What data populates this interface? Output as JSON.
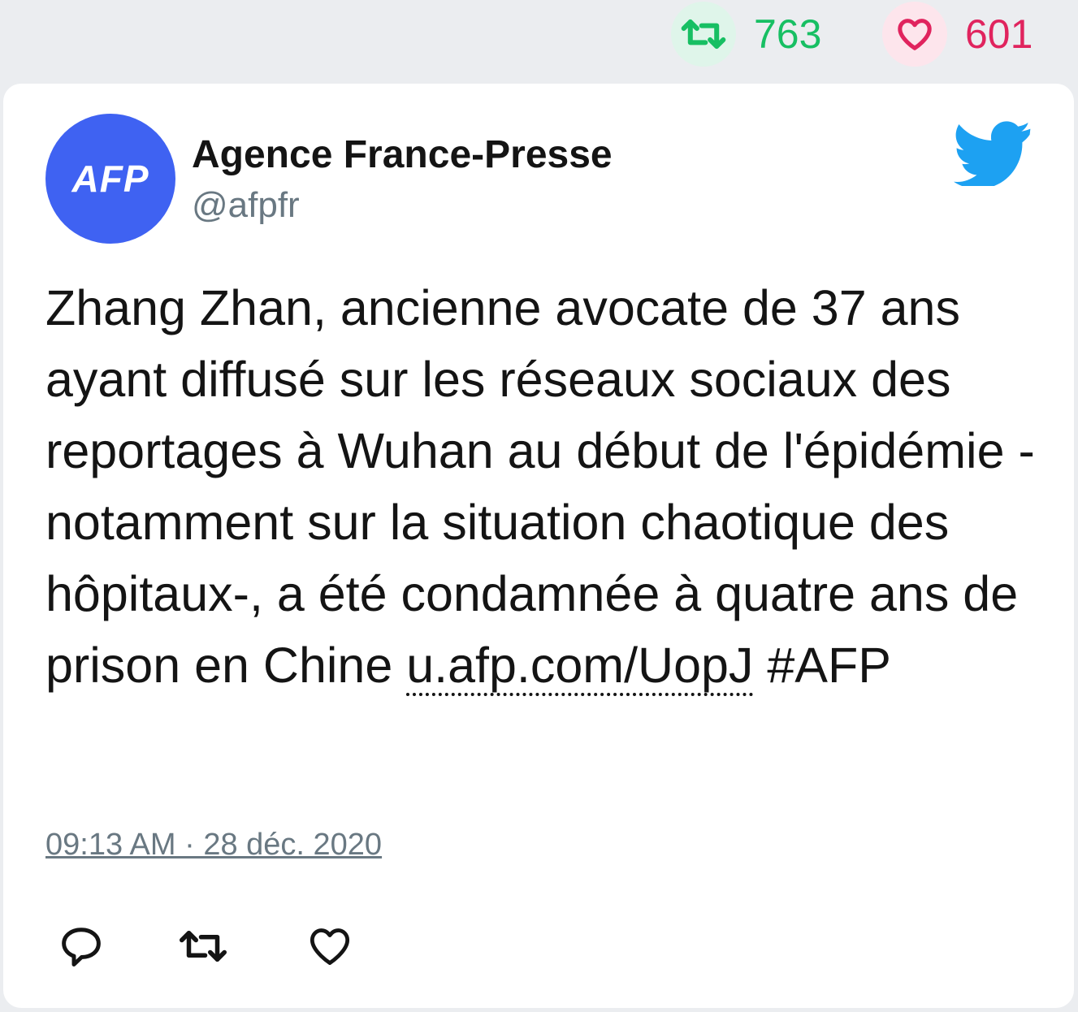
{
  "stats": {
    "retweet_count": "763",
    "like_count": "601"
  },
  "author": {
    "avatar_text": "AFP",
    "name": "Agence France-Presse",
    "handle": "@afpfr"
  },
  "tweet": {
    "text_before_link": "Zhang Zhan, ancienne avocate de 37 ans ayant diffusé sur les réseaux sociaux des reportages à Wuhan au début de l'épidémie -notamment sur la situation chaotique des hôpitaux-, a été condamnée à quatre ans de prison en Chine ",
    "link_text": "u.afp.com/UopJ",
    "hashtag": " #AFP",
    "timestamp": "09:13 AM · 28 déc. 2020"
  },
  "icons": {
    "retweet": "retweet-icon",
    "like": "heart-icon",
    "reply": "reply-icon",
    "brand": "twitter-bird-icon"
  },
  "colors": {
    "retweet": "#17bf63",
    "like": "#e0245e",
    "avatar_bg": "#3f62f2",
    "twitter_blue": "#1da1f2"
  }
}
